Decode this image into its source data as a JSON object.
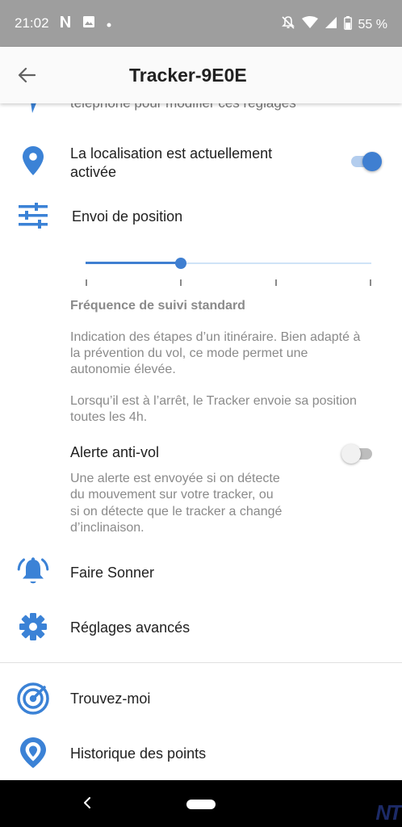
{
  "status_bar": {
    "time": "21:02",
    "notification_icons": [
      "n-app-icon",
      "image-icon",
      "dot-icon"
    ],
    "system_icons": [
      "mute-icon",
      "wifi-icon",
      "signal-icon",
      "battery-icon"
    ],
    "battery_text": "55 %"
  },
  "app_bar": {
    "title": "Tracker-9E0E"
  },
  "settings": {
    "cut_off_text": "téléphone pour modifier ces réglages",
    "location": {
      "label_line1": "La localisation est actuellement",
      "label_line2": "activée",
      "toggle_on": true
    },
    "position": {
      "label": "Envoi de position",
      "slider_steps": 4,
      "slider_index": 1,
      "mode_title": "Fréquence de suivi standard",
      "desc_line1": "Indication des étapes d’un itinéraire. Bien adapté à",
      "desc_line2": "la prévention du vol, ce mode permet une",
      "desc_line3": "autonomie élevée.",
      "stop_line1": "Lorsqu’il est à l’arrêt, le Tracker envoie sa position",
      "stop_line2": "toutes les 4h."
    },
    "anti_theft": {
      "label": "Alerte anti-vol",
      "toggle_on": false,
      "desc_line1": "Une alerte est envoyée si on détecte",
      "desc_line2": "du mouvement sur votre tracker, ou",
      "desc_line3": "si on détecte que le tracker a changé",
      "desc_line4": "d’inclinaison."
    },
    "ring": {
      "label": "Faire Sonner"
    },
    "advanced": {
      "label": "Réglages avancés"
    }
  },
  "menu": {
    "find_me": {
      "label": "Trouvez-moi"
    },
    "history": {
      "label": "Historique des points"
    }
  },
  "watermark": "NT",
  "colors": {
    "accent": "#3f7fd1",
    "status_bar": "#9e9e9e",
    "icon_blue": "#3b82d6"
  }
}
